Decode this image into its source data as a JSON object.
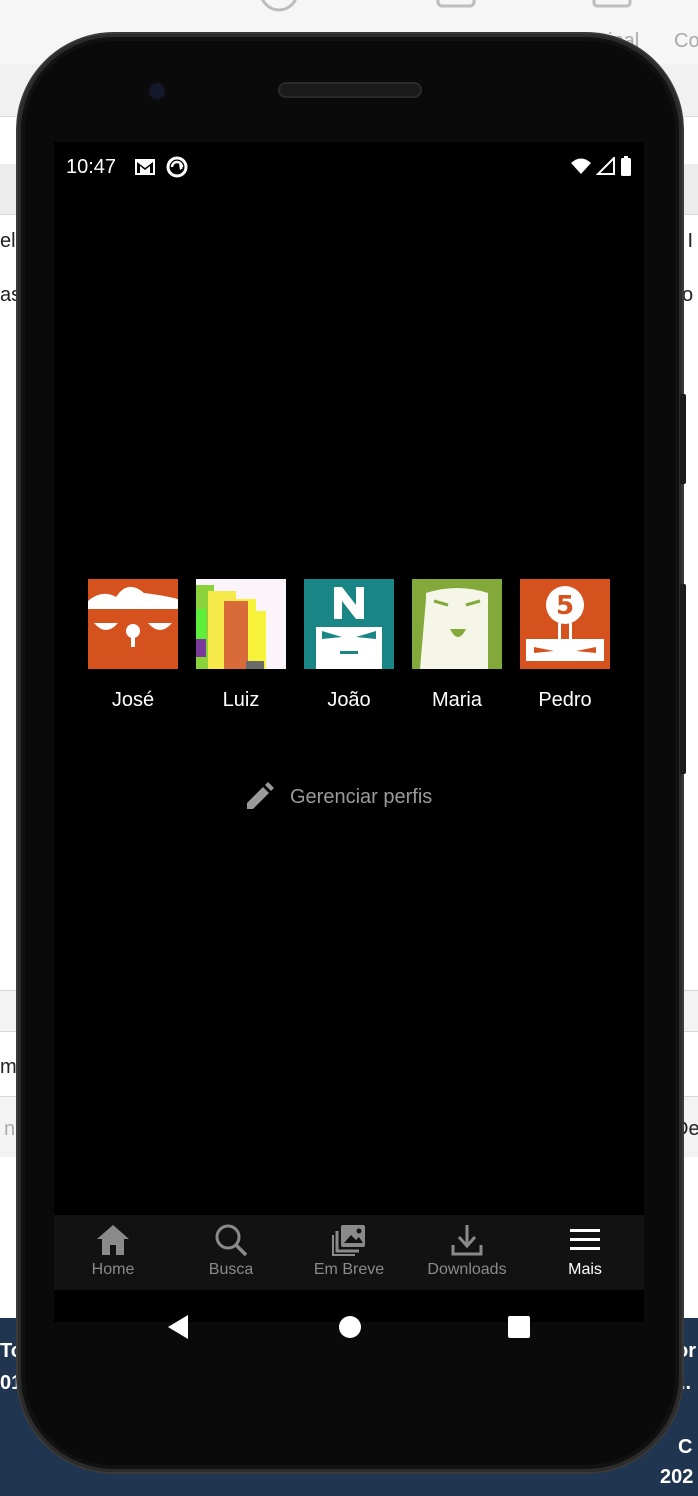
{
  "status_bar": {
    "time": "10:47",
    "icons_left": [
      "gmail-icon",
      "sync-icon"
    ],
    "icons_right": [
      "wifi-icon",
      "signal-icon",
      "battery-icon"
    ]
  },
  "profiles": [
    {
      "name": "José",
      "color": "#d5521f",
      "icon": "avatar-jose"
    },
    {
      "name": "Luiz",
      "color": "#ffffff",
      "icon": "avatar-luiz"
    },
    {
      "name": "João",
      "color": "#1a8585",
      "icon": "avatar-joao"
    },
    {
      "name": "Maria",
      "color": "#82a93a",
      "icon": "avatar-maria"
    },
    {
      "name": "Pedro",
      "color": "#d5521f",
      "icon": "avatar-pedro"
    }
  ],
  "manage_profiles": {
    "label": "Gerenciar perfis",
    "icon": "pencil-icon"
  },
  "bottom_nav": {
    "items": [
      {
        "label": "Home",
        "icon": "home-icon",
        "active": false
      },
      {
        "label": "Busca",
        "icon": "search-icon",
        "active": false
      },
      {
        "label": "Em Breve",
        "icon": "coming-soon-icon",
        "active": false
      },
      {
        "label": "Downloads",
        "icon": "download-icon",
        "active": false
      },
      {
        "label": "Mais",
        "icon": "menu-icon",
        "active": true
      }
    ]
  },
  "system_nav": {
    "icons": [
      "back-icon",
      "home-circle-icon",
      "recents-icon"
    ]
  },
  "background_page": {
    "fragments": [
      "inal",
      "Co",
      "ela",
      "as",
      "s I",
      "o",
      "m",
      "n",
      "De",
      "To",
      "01",
      "or",
      "..",
      "C",
      "202"
    ]
  },
  "colors": {
    "screen_bg": "#000000",
    "nav_bg": "#121212",
    "text_primary": "#ffffff",
    "text_secondary": "#9a9a9a"
  }
}
